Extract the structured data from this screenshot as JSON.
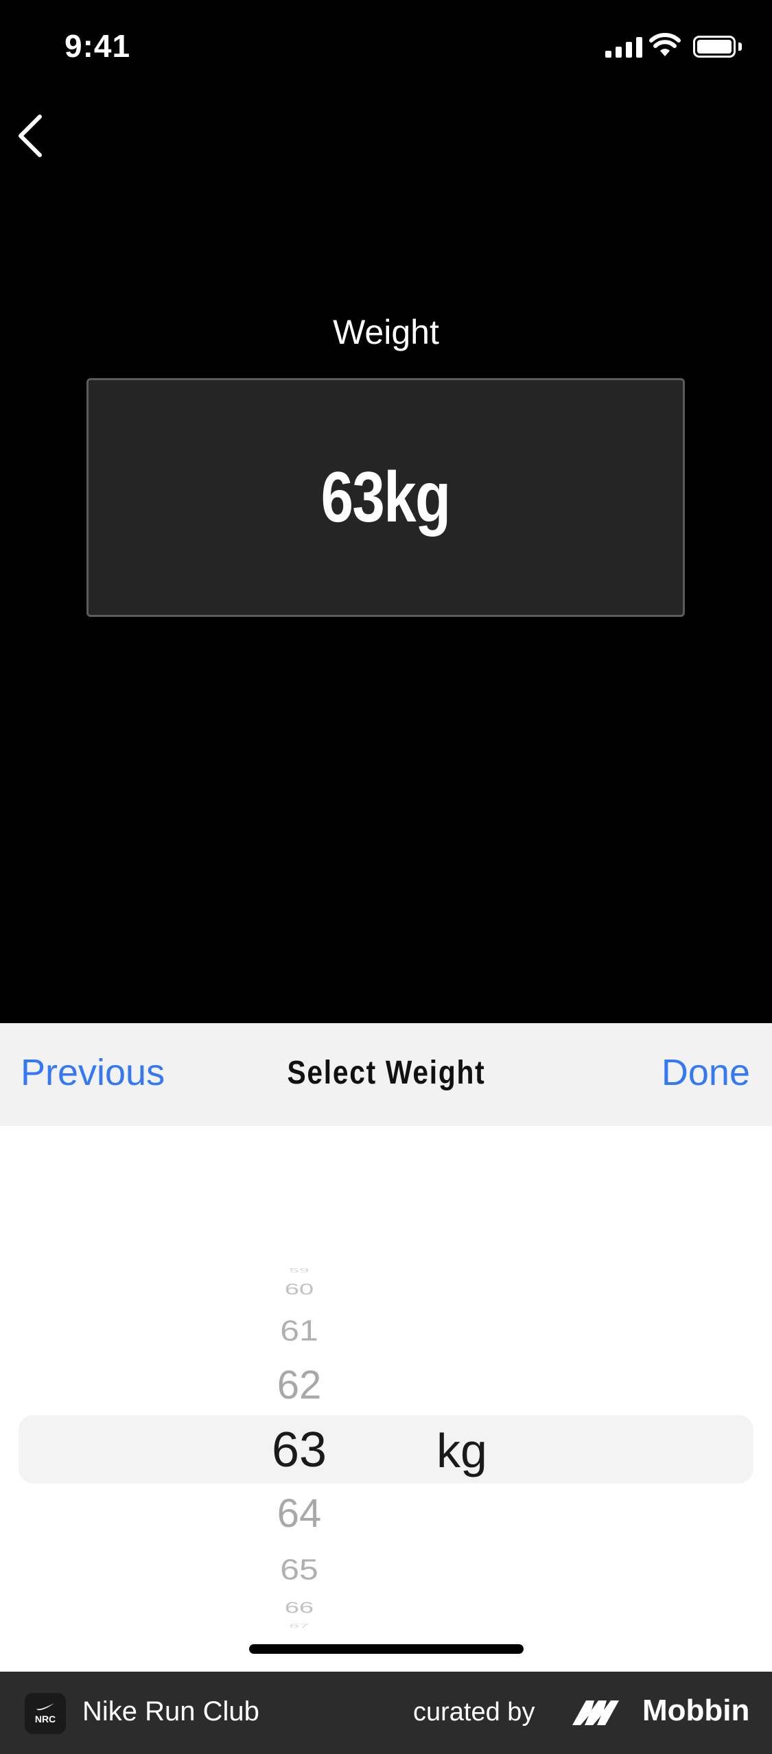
{
  "status_bar": {
    "time": "9:41"
  },
  "screen": {
    "field_label": "Weight",
    "field_value": "63kg"
  },
  "toolbar": {
    "previous_label": "Previous",
    "title": "Select Weight",
    "done_label": "Done"
  },
  "picker": {
    "items": [
      "59",
      "60",
      "61",
      "62",
      "63",
      "64",
      "65",
      "66",
      "67"
    ],
    "selected": "63",
    "unit": "kg"
  },
  "footer": {
    "app_name": "Nike Run Club",
    "app_icon_text": "NRC",
    "curated_by": "curated by",
    "brand": "Mobbin"
  },
  "colors": {
    "accent": "#3478f6",
    "background": "#000000",
    "field_bg": "#252525",
    "toolbar_bg": "#f2f2f2"
  },
  "icons": [
    "back-chevron-icon",
    "signal-icon",
    "wifi-icon",
    "battery-icon",
    "nike-swoosh-icon",
    "mobbin-logo-icon"
  ]
}
